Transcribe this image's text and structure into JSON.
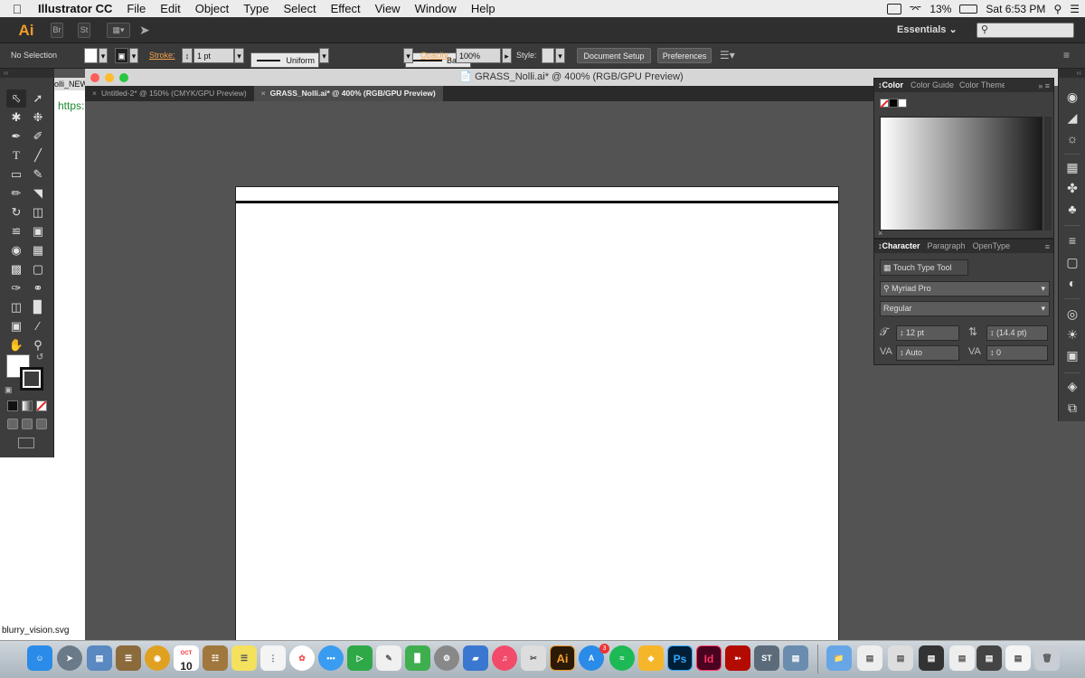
{
  "menubar": {
    "app_name": "Illustrator CC",
    "menus": [
      "File",
      "Edit",
      "Object",
      "Type",
      "Select",
      "Effect",
      "View",
      "Window",
      "Help"
    ],
    "battery": "13%",
    "clock": "Sat 6:53 PM"
  },
  "appbar": {
    "logo": "Ai",
    "bridge_label": "Br",
    "stock_label": "St",
    "workspace": "Essentials"
  },
  "controlbar": {
    "selection": "No Selection",
    "stroke_label": "Stroke:",
    "stroke_value": "1 pt",
    "profile": "Uniform",
    "brush": "Basic",
    "opacity_label": "Opacity:",
    "opacity_value": "100%",
    "style_label": "Style:",
    "document_setup": "Document Setup",
    "preferences": "Preferences"
  },
  "background_window": {
    "title": "olli_NEW",
    "url_fragment": "https:",
    "file_label": "blurry_vision.svg"
  },
  "document": {
    "window_title": "GRASS_Nolli.ai* @ 400% (RGB/GPU Preview)",
    "tabs": [
      {
        "label": "Untitled-2* @ 150% (CMYK/GPU Preview)",
        "active": false
      },
      {
        "label": "GRASS_Nolli.ai* @ 400% (RGB/GPU Preview)",
        "active": true
      }
    ]
  },
  "color_panel": {
    "tabs": [
      "Color",
      "Color Guide",
      "Color Themes"
    ]
  },
  "character_panel": {
    "tabs": [
      "Character",
      "Paragraph",
      "OpenType"
    ],
    "touch_type": "Touch Type Tool",
    "font_family": "Myriad Pro",
    "font_style": "Regular",
    "font_size": "12 pt",
    "leading": "(14.4 pt)",
    "kerning": "Auto",
    "tracking": "0"
  },
  "dock": {
    "calendar_month": "OCT",
    "calendar_day": "10",
    "appstore_badge": "3",
    "apps": [
      "Finder",
      "Launchpad",
      "Preview",
      "Notes",
      "Chrome",
      "Calendar",
      "Notebook",
      "Stickies",
      "Reminders",
      "Photos",
      "Messages",
      "FaceTime",
      "TextEdit",
      "Numbers",
      "System Preferences",
      "Keynote",
      "iTunes",
      "Scissors",
      "Illustrator",
      "App Store",
      "Spotify",
      "Sketch",
      "Photoshop",
      "InDesign",
      "Acrobat",
      "Stock",
      "Preview Stack",
      "Folder",
      "Downloads",
      "Trash"
    ]
  }
}
